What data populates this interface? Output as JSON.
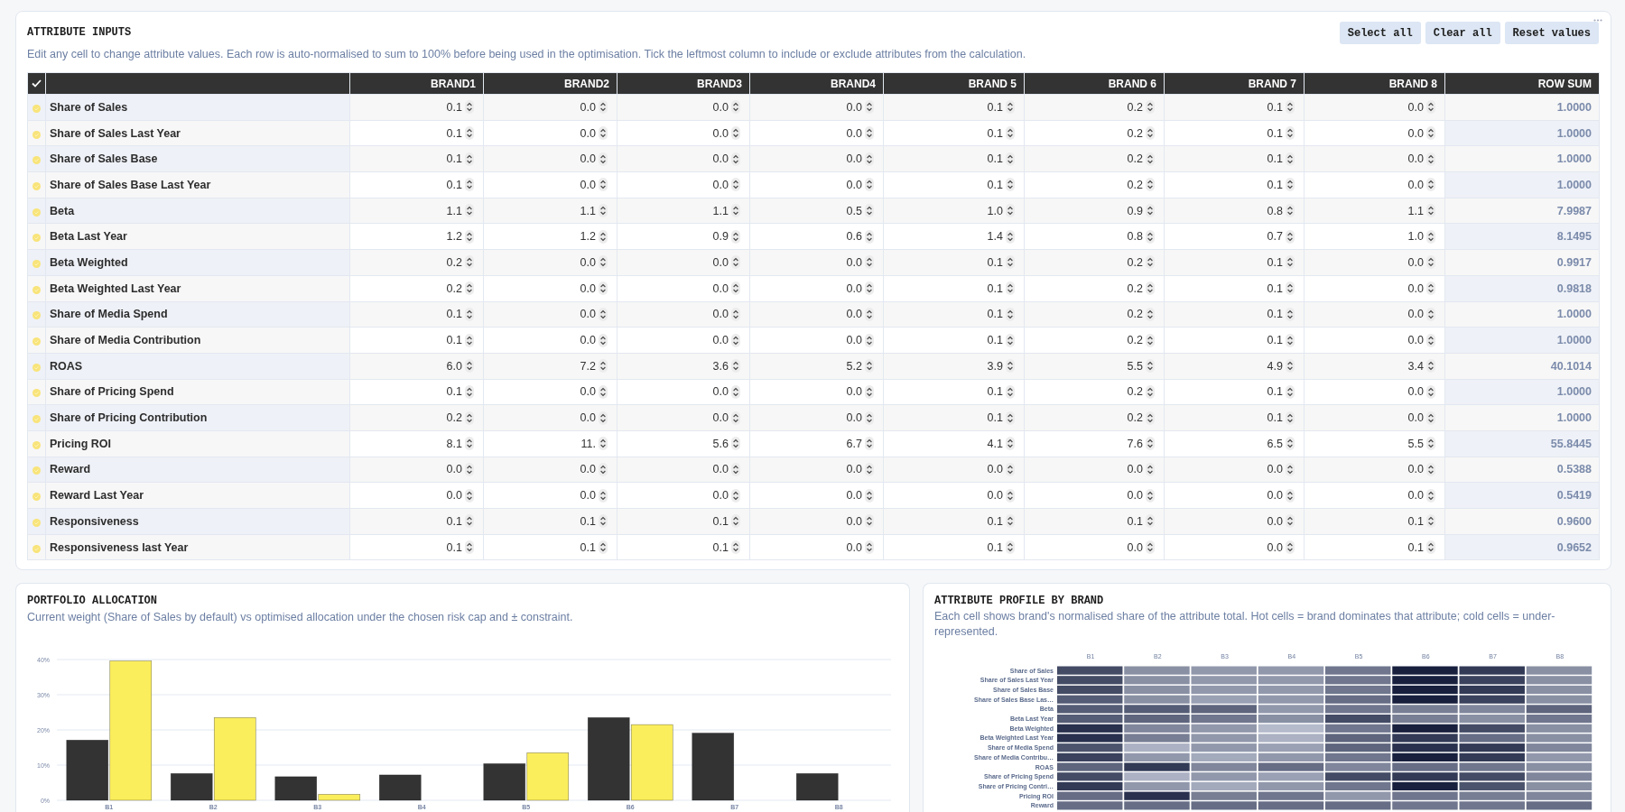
{
  "attribute_inputs": {
    "title": "ATTRIBUTE INPUTS",
    "description": "Edit any cell to change attribute values. Each row is auto-normalised to sum to 100% before being used in the optimisation. Tick the leftmost column to include or exclude attributes from the calculation.",
    "buttons": [
      "Select all",
      "Clear all",
      "Reset values"
    ],
    "table": {
      "columns": [
        "BRAND1",
        "BRAND2",
        "BRAND3",
        "BRAND4",
        "BRAND 5",
        "BRAND 6",
        "BRAND 7",
        "BRAND 8"
      ],
      "row_sum_column": "ROW SUM",
      "rows": [
        {
          "included": true,
          "name": "Share of Sales",
          "values": [
            "0.1",
            "0.0",
            "0.0",
            "0.0",
            "0.1",
            "0.2",
            "0.1",
            "0.0"
          ],
          "row_sum": "1.0000"
        },
        {
          "included": true,
          "name": "Share of Sales Last Year",
          "values": [
            "0.1",
            "0.0",
            "0.0",
            "0.0",
            "0.1",
            "0.2",
            "0.1",
            "0.0"
          ],
          "row_sum": "1.0000"
        },
        {
          "included": true,
          "name": "Share of Sales Base",
          "values": [
            "0.1",
            "0.0",
            "0.0",
            "0.0",
            "0.1",
            "0.2",
            "0.1",
            "0.0"
          ],
          "row_sum": "1.0000"
        },
        {
          "included": true,
          "name": "Share of Sales Base Last Year",
          "values": [
            "0.1",
            "0.0",
            "0.0",
            "0.0",
            "0.1",
            "0.2",
            "0.1",
            "0.0"
          ],
          "row_sum": "1.0000"
        },
        {
          "included": true,
          "name": "Beta",
          "values": [
            "1.1",
            "1.1",
            "1.1",
            "0.5",
            "1.0",
            "0.9",
            "0.8",
            "1.1"
          ],
          "row_sum": "7.9987"
        },
        {
          "included": true,
          "name": "Beta Last Year",
          "values": [
            "1.2",
            "1.2",
            "0.9",
            "0.6",
            "1.4",
            "0.8",
            "0.7",
            "1.0"
          ],
          "row_sum": "8.1495"
        },
        {
          "included": true,
          "name": "Beta Weighted",
          "values": [
            "0.2",
            "0.0",
            "0.0",
            "0.0",
            "0.1",
            "0.2",
            "0.1",
            "0.0"
          ],
          "row_sum": "0.9917"
        },
        {
          "included": true,
          "name": "Beta Weighted Last Year",
          "values": [
            "0.2",
            "0.0",
            "0.0",
            "0.0",
            "0.1",
            "0.2",
            "0.1",
            "0.0"
          ],
          "row_sum": "0.9818"
        },
        {
          "included": true,
          "name": "Share of Media Spend",
          "values": [
            "0.1",
            "0.0",
            "0.0",
            "0.0",
            "0.1",
            "0.2",
            "0.1",
            "0.0"
          ],
          "row_sum": "1.0000"
        },
        {
          "included": true,
          "name": "Share of Media Contribution",
          "values": [
            "0.1",
            "0.0",
            "0.0",
            "0.0",
            "0.1",
            "0.2",
            "0.1",
            "0.0"
          ],
          "row_sum": "1.0000"
        },
        {
          "included": true,
          "name": "ROAS",
          "values": [
            "6.0",
            "7.2",
            "3.6",
            "5.2",
            "3.9",
            "5.5",
            "4.9",
            "3.4"
          ],
          "row_sum": "40.1014"
        },
        {
          "included": true,
          "name": "Share of Pricing Spend",
          "values": [
            "0.1",
            "0.0",
            "0.0",
            "0.0",
            "0.1",
            "0.2",
            "0.1",
            "0.0"
          ],
          "row_sum": "1.0000"
        },
        {
          "included": true,
          "name": "Share of Pricing Contribution",
          "values": [
            "0.2",
            "0.0",
            "0.0",
            "0.0",
            "0.1",
            "0.2",
            "0.1",
            "0.0"
          ],
          "row_sum": "1.0000"
        },
        {
          "included": true,
          "name": "Pricing ROI",
          "values": [
            "8.1",
            "11.",
            "5.6",
            "6.7",
            "4.1",
            "7.6",
            "6.5",
            "5.5"
          ],
          "row_sum": "55.8445"
        },
        {
          "included": true,
          "name": "Reward",
          "values": [
            "0.0",
            "0.0",
            "0.0",
            "0.0",
            "0.0",
            "0.0",
            "0.0",
            "0.0"
          ],
          "row_sum": "0.5388"
        },
        {
          "included": true,
          "name": "Reward Last Year",
          "values": [
            "0.0",
            "0.0",
            "0.0",
            "0.0",
            "0.0",
            "0.0",
            "0.0",
            "0.0"
          ],
          "row_sum": "0.5419"
        },
        {
          "included": true,
          "name": "Responsiveness",
          "values": [
            "0.1",
            "0.1",
            "0.1",
            "0.0",
            "0.1",
            "0.1",
            "0.0",
            "0.1"
          ],
          "row_sum": "0.9600"
        },
        {
          "included": true,
          "name": "Responsiveness last Year",
          "values": [
            "0.1",
            "0.1",
            "0.1",
            "0.0",
            "0.1",
            "0.0",
            "0.0",
            "0.1"
          ],
          "row_sum": "0.9652"
        }
      ]
    }
  },
  "portfolio_allocation": {
    "title": "PORTFOLIO ALLOCATION",
    "description": "Current weight (Share of Sales by default) vs optimised allocation under the chosen risk cap and ± constraint.",
    "chart_data": {
      "type": "bar",
      "grid": true,
      "categories": [
        "B1",
        "B2",
        "B3",
        "B4",
        "B5",
        "B6",
        "B7",
        "B8"
      ],
      "series": [
        {
          "color": "#333333",
          "values": [
            17.1,
            7.6,
            6.7,
            7.2,
            10.4,
            23.5,
            19.1,
            7.6
          ]
        },
        {
          "color": "#fbee5c",
          "values": [
            39.6,
            23.5,
            1.7,
            0,
            13.5,
            21.5,
            0,
            0
          ]
        }
      ],
      "ylim": [
        0,
        40
      ],
      "yticks": [
        {
          "value": 0,
          "label": "0%"
        },
        {
          "value": 10,
          "label": "10%"
        },
        {
          "value": 20,
          "label": "20%"
        },
        {
          "value": 30,
          "label": "30%"
        },
        {
          "value": 40,
          "label": "40%"
        }
      ]
    }
  },
  "attribute_profile": {
    "title": "ATTRIBUTE PROFILE BY BRAND",
    "description": "Each cell shows brand's normalised share of the attribute total. Hot cells = brand dominates that attribute; cold cells = under-represented.",
    "columns": [
      "B1",
      "B2",
      "B3",
      "B4",
      "B5",
      "B6",
      "B7",
      "B8"
    ],
    "rows": [
      "Share of Sales",
      "Share of Sales Last Year",
      "Share of Sales Base",
      "Share of Sales Base Las…",
      "Beta",
      "Beta Last Year",
      "Beta Weighted",
      "Beta Weighted Last Year",
      "Share of Media Spend",
      "Share of Media Contribu…",
      "ROAS",
      "Share of Pricing Spend",
      "Share of Pricing Contri…",
      "Pricing ROI",
      "Reward"
    ]
  }
}
